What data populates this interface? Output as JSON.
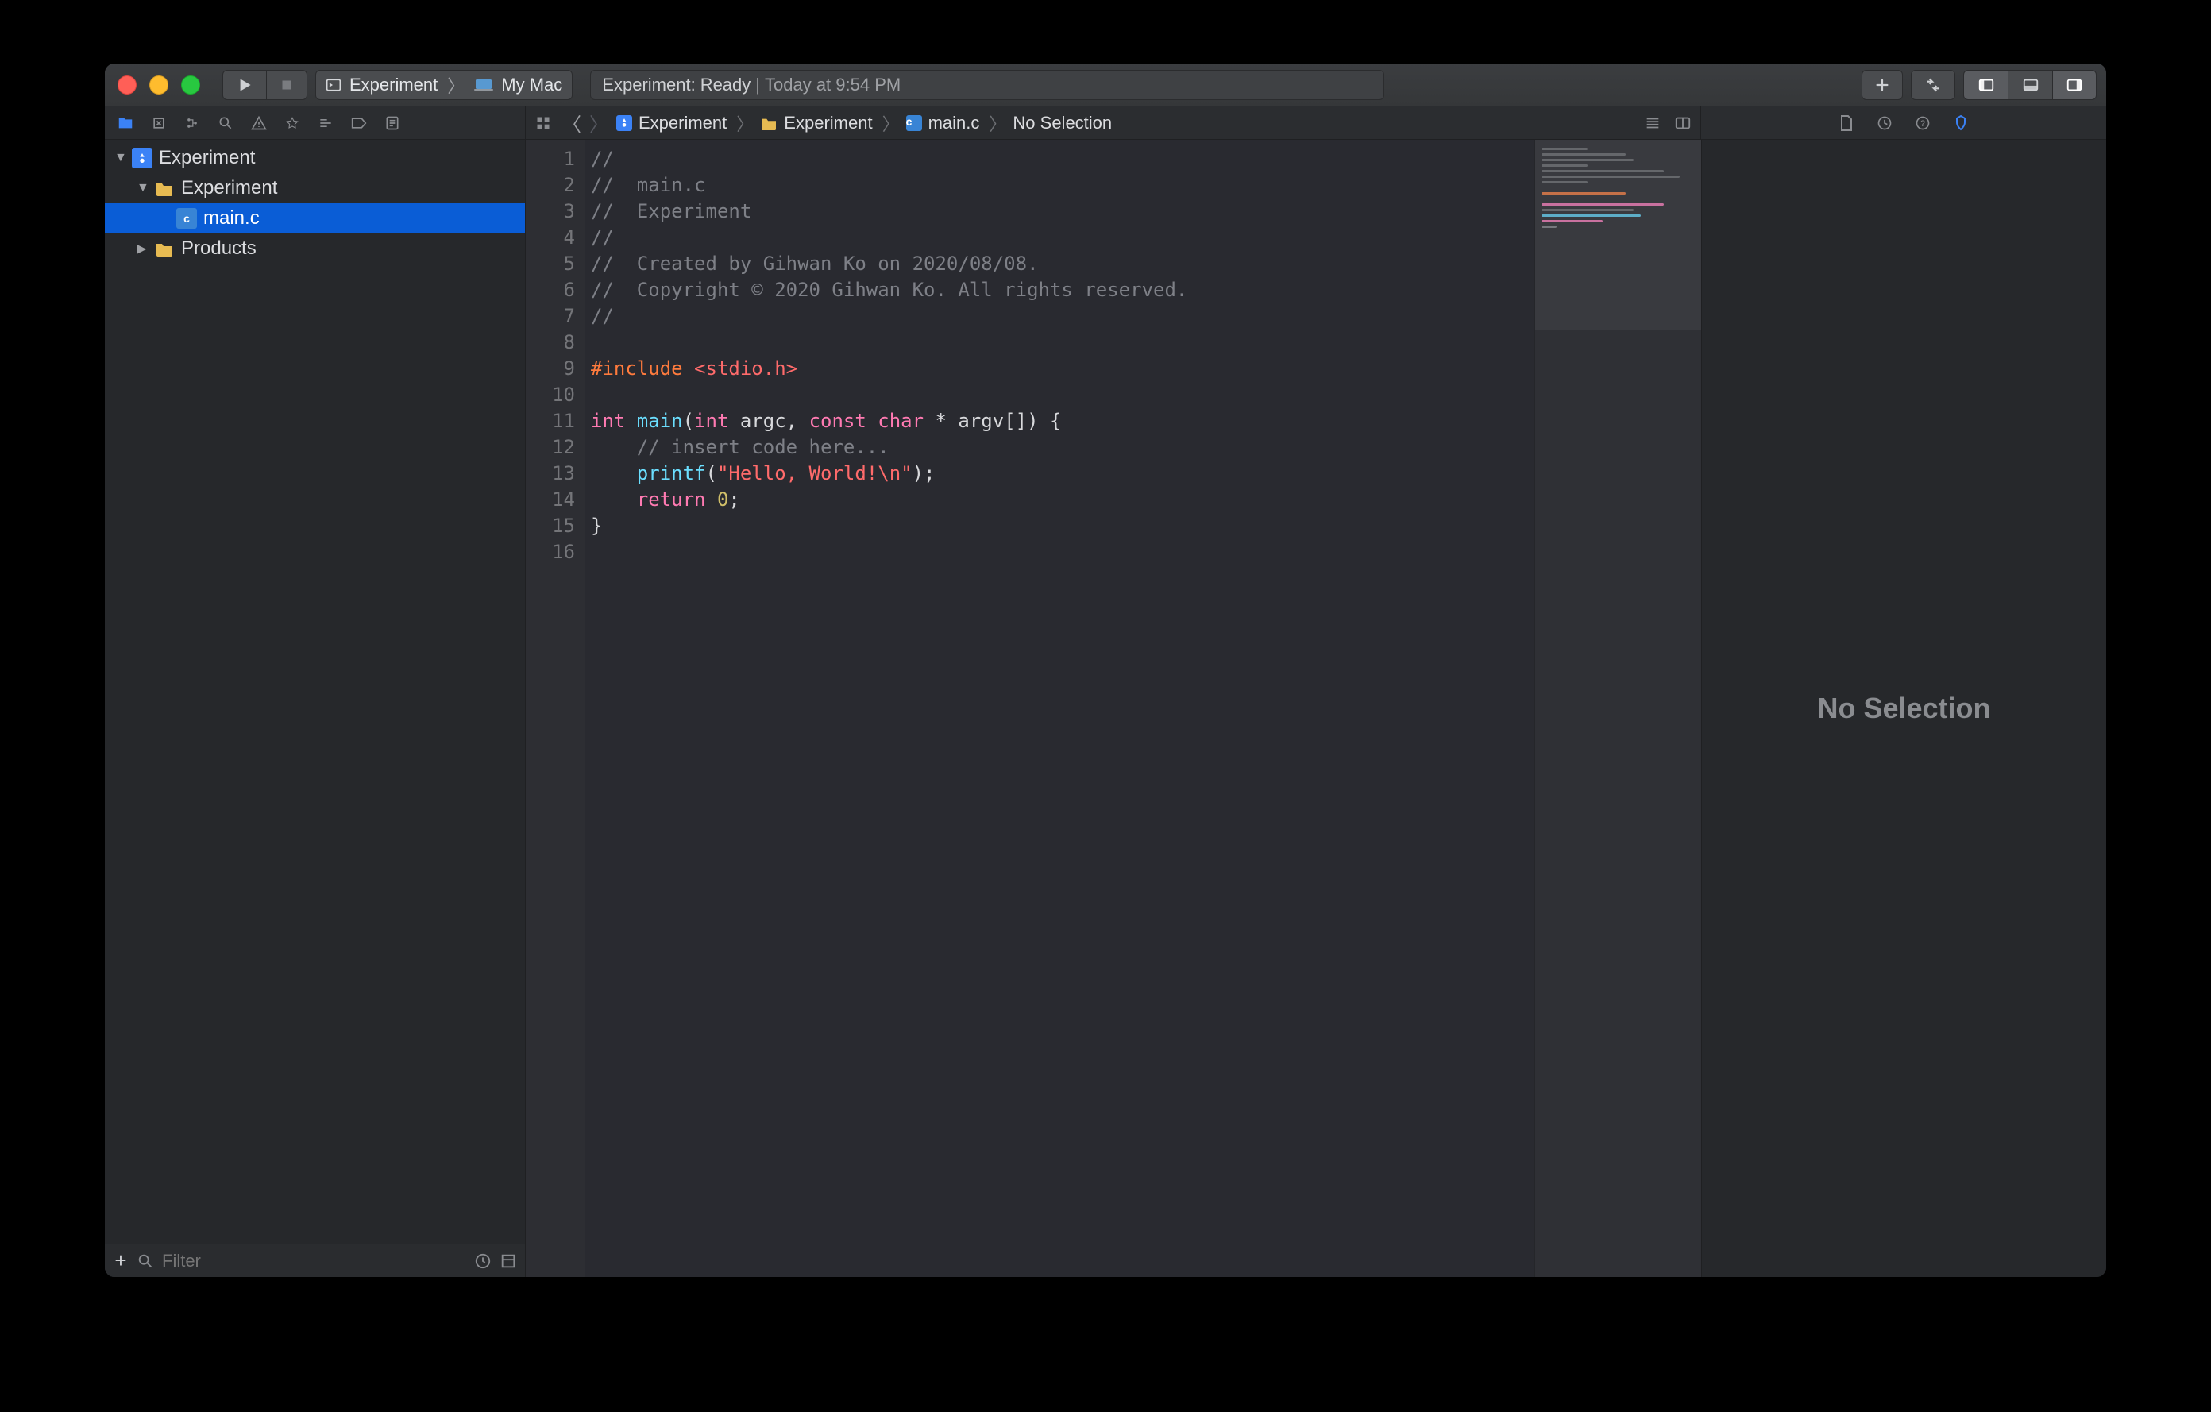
{
  "window": {
    "traffic": {
      "close": "close",
      "min": "minimize",
      "max": "zoom"
    }
  },
  "toolbar": {
    "run_tooltip": "Run",
    "stop_tooltip": "Stop",
    "scheme_name": "Experiment",
    "scheme_target": "My Mac",
    "activity_prefix": "Experiment: ",
    "activity_state": "Ready",
    "activity_sep": " | ",
    "activity_time": "Today at 9:54 PM",
    "add_tooltip": "Library",
    "review_tooltip": "Code Review"
  },
  "nav": {
    "grid_tooltip": "Related Items",
    "back_tooltip": "Back",
    "fwd_tooltip": "Forward",
    "crumbs": [
      {
        "icon": "proj",
        "label": "Experiment"
      },
      {
        "icon": "folder",
        "label": "Experiment"
      },
      {
        "icon": "c",
        "label": "main.c"
      },
      {
        "icon": "",
        "label": "No Selection"
      }
    ]
  },
  "sidebar": {
    "tree": [
      {
        "level": 0,
        "disclosure": "▼",
        "icon": "proj",
        "label": "Experiment"
      },
      {
        "level": 1,
        "disclosure": "▼",
        "icon": "folder",
        "label": "Experiment"
      },
      {
        "level": 2,
        "disclosure": "",
        "icon": "c",
        "label": "main.c",
        "selected": true
      },
      {
        "level": 1,
        "disclosure": "▶",
        "icon": "folder",
        "label": "Products"
      }
    ],
    "filter_placeholder": "Filter",
    "add_label": "+"
  },
  "editor": {
    "lines": [
      {
        "n": 1,
        "t": [
          [
            "comment",
            "//"
          ]
        ]
      },
      {
        "n": 2,
        "t": [
          [
            "comment",
            "//  main.c"
          ]
        ]
      },
      {
        "n": 3,
        "t": [
          [
            "comment",
            "//  Experiment"
          ]
        ]
      },
      {
        "n": 4,
        "t": [
          [
            "comment",
            "//"
          ]
        ]
      },
      {
        "n": 5,
        "t": [
          [
            "comment",
            "//  Created by Gihwan Ko on 2020/08/08."
          ]
        ]
      },
      {
        "n": 6,
        "t": [
          [
            "comment",
            "//  Copyright © 2020 Gihwan Ko. All rights reserved."
          ]
        ]
      },
      {
        "n": 7,
        "t": [
          [
            "comment",
            "//"
          ]
        ]
      },
      {
        "n": 8,
        "t": [
          [
            "plain",
            ""
          ]
        ]
      },
      {
        "n": 9,
        "t": [
          [
            "pre",
            "#include "
          ],
          [
            "incfile",
            "<stdio.h>"
          ]
        ]
      },
      {
        "n": 10,
        "t": [
          [
            "plain",
            ""
          ]
        ]
      },
      {
        "n": 11,
        "t": [
          [
            "kw",
            "int "
          ],
          [
            "fn",
            "main"
          ],
          [
            "plain",
            "("
          ],
          [
            "kw",
            "int"
          ],
          [
            "plain",
            " argc, "
          ],
          [
            "kw",
            "const char"
          ],
          [
            "plain",
            " * argv[]) {"
          ]
        ]
      },
      {
        "n": 12,
        "t": [
          [
            "plain",
            "    "
          ],
          [
            "comment",
            "// insert code here..."
          ]
        ]
      },
      {
        "n": 13,
        "t": [
          [
            "plain",
            "    "
          ],
          [
            "fn",
            "printf"
          ],
          [
            "plain",
            "("
          ],
          [
            "str",
            "\"Hello, World!\\n\""
          ],
          [
            "plain",
            ");"
          ]
        ]
      },
      {
        "n": 14,
        "t": [
          [
            "plain",
            "    "
          ],
          [
            "kw",
            "return"
          ],
          [
            "plain",
            " "
          ],
          [
            "num",
            "0"
          ],
          [
            "plain",
            ";"
          ]
        ]
      },
      {
        "n": 15,
        "t": [
          [
            "plain",
            "}"
          ]
        ]
      },
      {
        "n": 16,
        "t": [
          [
            "plain",
            ""
          ]
        ]
      }
    ]
  },
  "inspector": {
    "empty_text": "No Selection"
  },
  "colors": {
    "accent": "#0a5dd6"
  }
}
